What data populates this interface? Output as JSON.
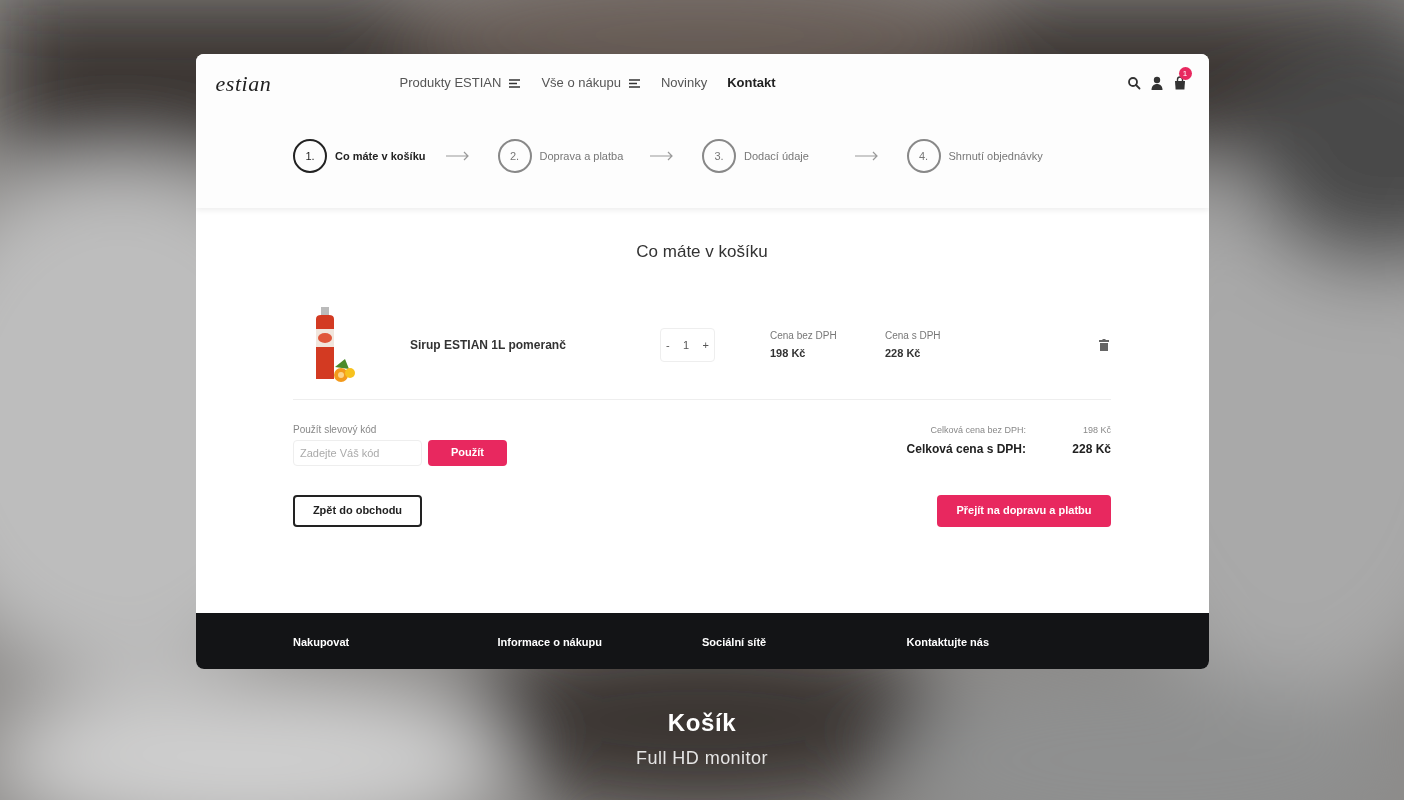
{
  "header": {
    "logo": "estian",
    "nav": [
      {
        "label": "Produkty ESTIAN",
        "kind": "dropdown",
        "selected": false
      },
      {
        "label": "Vše o nákupu",
        "kind": "dropdown",
        "selected": false
      },
      {
        "label": "Novinky",
        "kind": "link",
        "selected": false
      },
      {
        "label": "Kontakt",
        "kind": "link",
        "selected": true
      }
    ],
    "cart_count": "1"
  },
  "steps": [
    {
      "number": "1.",
      "label": "Co máte v košíku",
      "selected": true
    },
    {
      "number": "2.",
      "label": "Doprava a platba",
      "selected": false
    },
    {
      "number": "3.",
      "label": "Dodací údaje",
      "selected": false
    },
    {
      "number": "4.",
      "label": "Shrnutí objednávky",
      "selected": false
    }
  ],
  "cart": {
    "title": "Co máte v košíku",
    "items": [
      {
        "kind": "picture",
        "name": "Sirup ESTIAN 1L pomeranč",
        "quantity": "1",
        "minus": "-",
        "plus": "+",
        "price_without_vat_label": "Cena bez DPH",
        "price_without_vat": "198 Kč",
        "price_with_vat_label": "Cena s DPH",
        "price_with_vat": "228 Kč"
      }
    ],
    "discount": {
      "label": "Použít slevový kód",
      "placeholder": "Zadejte Váš kód",
      "button": "Použít"
    },
    "totals": [
      {
        "label": "Celková cena bez DPH:",
        "value": "198 Kč",
        "kind": "minor"
      },
      {
        "label": "Celková cena s DPH:",
        "value": "228 Kč",
        "kind": "major"
      }
    ],
    "back_button": "Zpět do obchodu",
    "next_button": "Přejít na dopravu a platbu"
  },
  "footer": {
    "columns": [
      "Nakupovat",
      "Informace o nákupu",
      "Sociální sítě",
      "Kontaktujte nás"
    ]
  },
  "caption": {
    "title": "Košík",
    "subtitle": "Full HD monitor"
  }
}
